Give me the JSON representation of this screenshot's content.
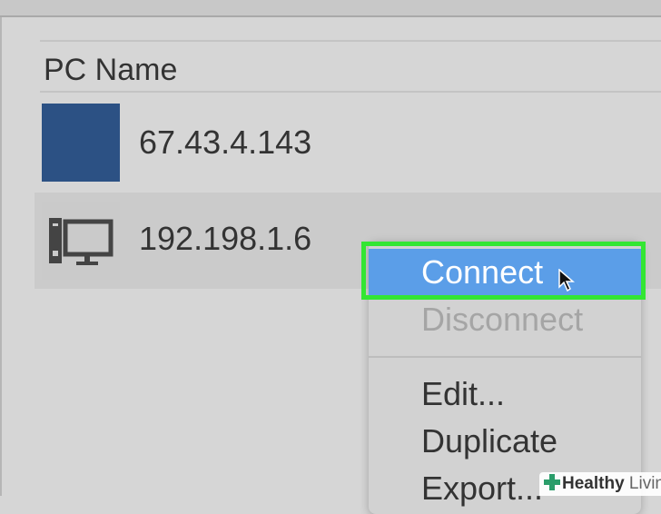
{
  "table": {
    "header": "PC Name",
    "rows": [
      {
        "name": "67.43.4.143",
        "icon": "desktop-screenshot-thumbnail"
      },
      {
        "name": "192.198.1.6",
        "icon": "computer-icon"
      }
    ]
  },
  "context_menu": {
    "items": [
      {
        "label": "Connect",
        "state": "highlighted"
      },
      {
        "label": "Disconnect",
        "state": "disabled"
      },
      {
        "label": "Edit..."
      },
      {
        "label": "Duplicate"
      },
      {
        "label": "Export..."
      }
    ]
  },
  "watermark": {
    "brand_bold": "Healthy",
    "brand_light": "Living"
  },
  "colors": {
    "highlight": "#5b9ee8",
    "callout": "#33e633",
    "thumbnail": "#2c5184"
  }
}
